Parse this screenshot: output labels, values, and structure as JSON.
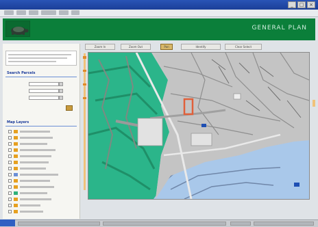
{
  "window": {
    "title": "",
    "controls": [
      "minimize-icon",
      "maximize-icon",
      "close-icon"
    ]
  },
  "header": {
    "brand": "GENERAL PLAN",
    "logo_icon": "turtle-logo-icon"
  },
  "left_panel": {
    "intro_title": "",
    "search_section": "Search Parcels",
    "layers_section": "Map Layers",
    "fields": [
      {
        "label": "",
        "value": ""
      },
      {
        "label": "",
        "value": ""
      },
      {
        "label": "",
        "value": ""
      }
    ],
    "layers": [
      {
        "color": "#e6a020"
      },
      {
        "color": "#e6a020"
      },
      {
        "color": "#e6a020"
      },
      {
        "color": "#e6a020"
      },
      {
        "color": "#e6a020"
      },
      {
        "color": "#e6a020"
      },
      {
        "color": "#e6a020"
      },
      {
        "color": "#6b8fd6"
      },
      {
        "color": "#e6a020"
      },
      {
        "color": "#e6a020"
      },
      {
        "color": "#2fb07a"
      },
      {
        "color": "#e6a020"
      },
      {
        "color": "#e6a020"
      },
      {
        "color": "#e6a020"
      }
    ]
  },
  "tabs": [
    {
      "label": "Zoom In"
    },
    {
      "label": "Zoom Out"
    },
    {
      "label": "Pan"
    },
    {
      "label": "Identify"
    },
    {
      "label": "Clear Select"
    }
  ],
  "map": {
    "caption": "",
    "colors": {
      "land": "#c7c7c7",
      "green_zone": "#2bb58a",
      "water_zone": "#a9c8ea",
      "parcel_highlight": "#e0603a",
      "road": "#e9e9e9",
      "pin": "#1e4fb3"
    }
  },
  "colors": {
    "titlebar": "#1c3f98",
    "header": "#0b7f3a",
    "accent": "#d8b86a"
  }
}
